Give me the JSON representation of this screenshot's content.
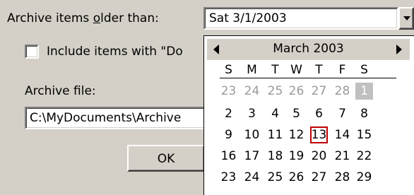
{
  "archive_label": "Archive items older than:",
  "archive_label_accel": "o",
  "date_value": "Sat 3/1/2003",
  "include_label": "Include items with \"Do",
  "include_checked": false,
  "archive_file_label": "Archive file:",
  "archive_file_value": "C:\\MyDocuments\\Archive",
  "ok_label": "OK",
  "calendar": {
    "month_title": "March 2003",
    "weekdays": [
      "S",
      "M",
      "T",
      "W",
      "T",
      "F",
      "S"
    ],
    "rows": [
      [
        "23",
        "24",
        "25",
        "26",
        "27",
        "28",
        "1"
      ],
      [
        "2",
        "3",
        "4",
        "5",
        "6",
        "7",
        "8"
      ],
      [
        "9",
        "10",
        "11",
        "12",
        "13",
        "14",
        "15"
      ],
      [
        "16",
        "17",
        "18",
        "19",
        "20",
        "21",
        "22"
      ],
      [
        "23",
        "24",
        "25",
        "26",
        "27",
        "28",
        "29"
      ]
    ],
    "selected_day": "1",
    "today_day": "13"
  },
  "colors": {
    "dialog_bg": "#d4d0c8",
    "today_outline": "#c00000",
    "other_month_text": "#9a9a9a",
    "selected_bg": "#c0c0c0"
  }
}
